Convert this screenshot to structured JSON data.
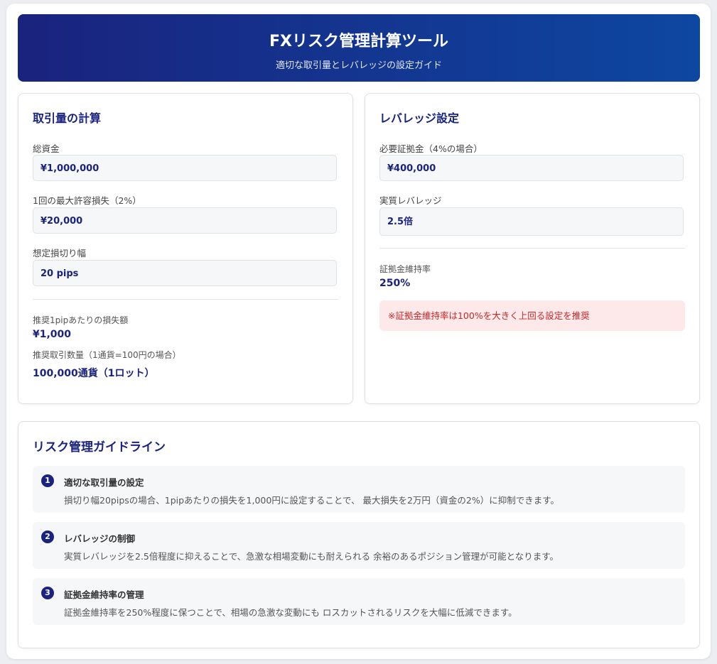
{
  "header": {
    "title": "FXリスク管理計算ツール",
    "subtitle": "適切な取引量とレバレッジの設定ガイド"
  },
  "volume": {
    "title": "取引量の計算",
    "capital_label": "総資金",
    "capital_value": "¥1,000,000",
    "max_loss_label": "1回の最大許容損失（2%）",
    "max_loss_value": "¥20,000",
    "stop_label": "想定損切り幅",
    "stop_value": "20 pips",
    "per_pip_label": "推奨1pipあたりの損失額",
    "per_pip_value": "¥1,000",
    "qty_label": "推奨取引数量（1通貨=100円の場合）",
    "qty_value": "100,000通貨（1ロット）"
  },
  "leverage": {
    "title": "レバレッジ設定",
    "margin_label": "必要証拠金（4%の場合）",
    "margin_value": "¥400,000",
    "real_lev_label": "実質レバレッジ",
    "real_lev_value": "2.5倍",
    "ratio_label": "証拠金維持率",
    "ratio_value": "250%",
    "note": "※証拠金維持率は100%を大きく上回る設定を推奨"
  },
  "guide": {
    "title": "リスク管理ガイドライン",
    "items": [
      {
        "num": "1",
        "title": "適切な取引量の設定",
        "desc": "損切り幅20pipsの場合、1pipあたりの損失を1,000円に設定することで、 最大損失を2万円（資金の2%）に抑制できます。"
      },
      {
        "num": "2",
        "title": "レバレッジの制御",
        "desc": "実質レバレッジを2.5倍程度に抑えることで、急激な相場変動にも耐えられる 余裕のあるポジション管理が可能となります。"
      },
      {
        "num": "3",
        "title": "証拠金維持率の管理",
        "desc": "証拠金維持率を250%程度に保つことで、相場の急激な変動にも ロスカットされるリスクを大幅に低減できます。"
      }
    ]
  },
  "colors": {
    "brand": "#1a237e",
    "brand_light": "#0d47a1",
    "warning_bg": "#fde8ea",
    "warning_text": "#c62828"
  }
}
